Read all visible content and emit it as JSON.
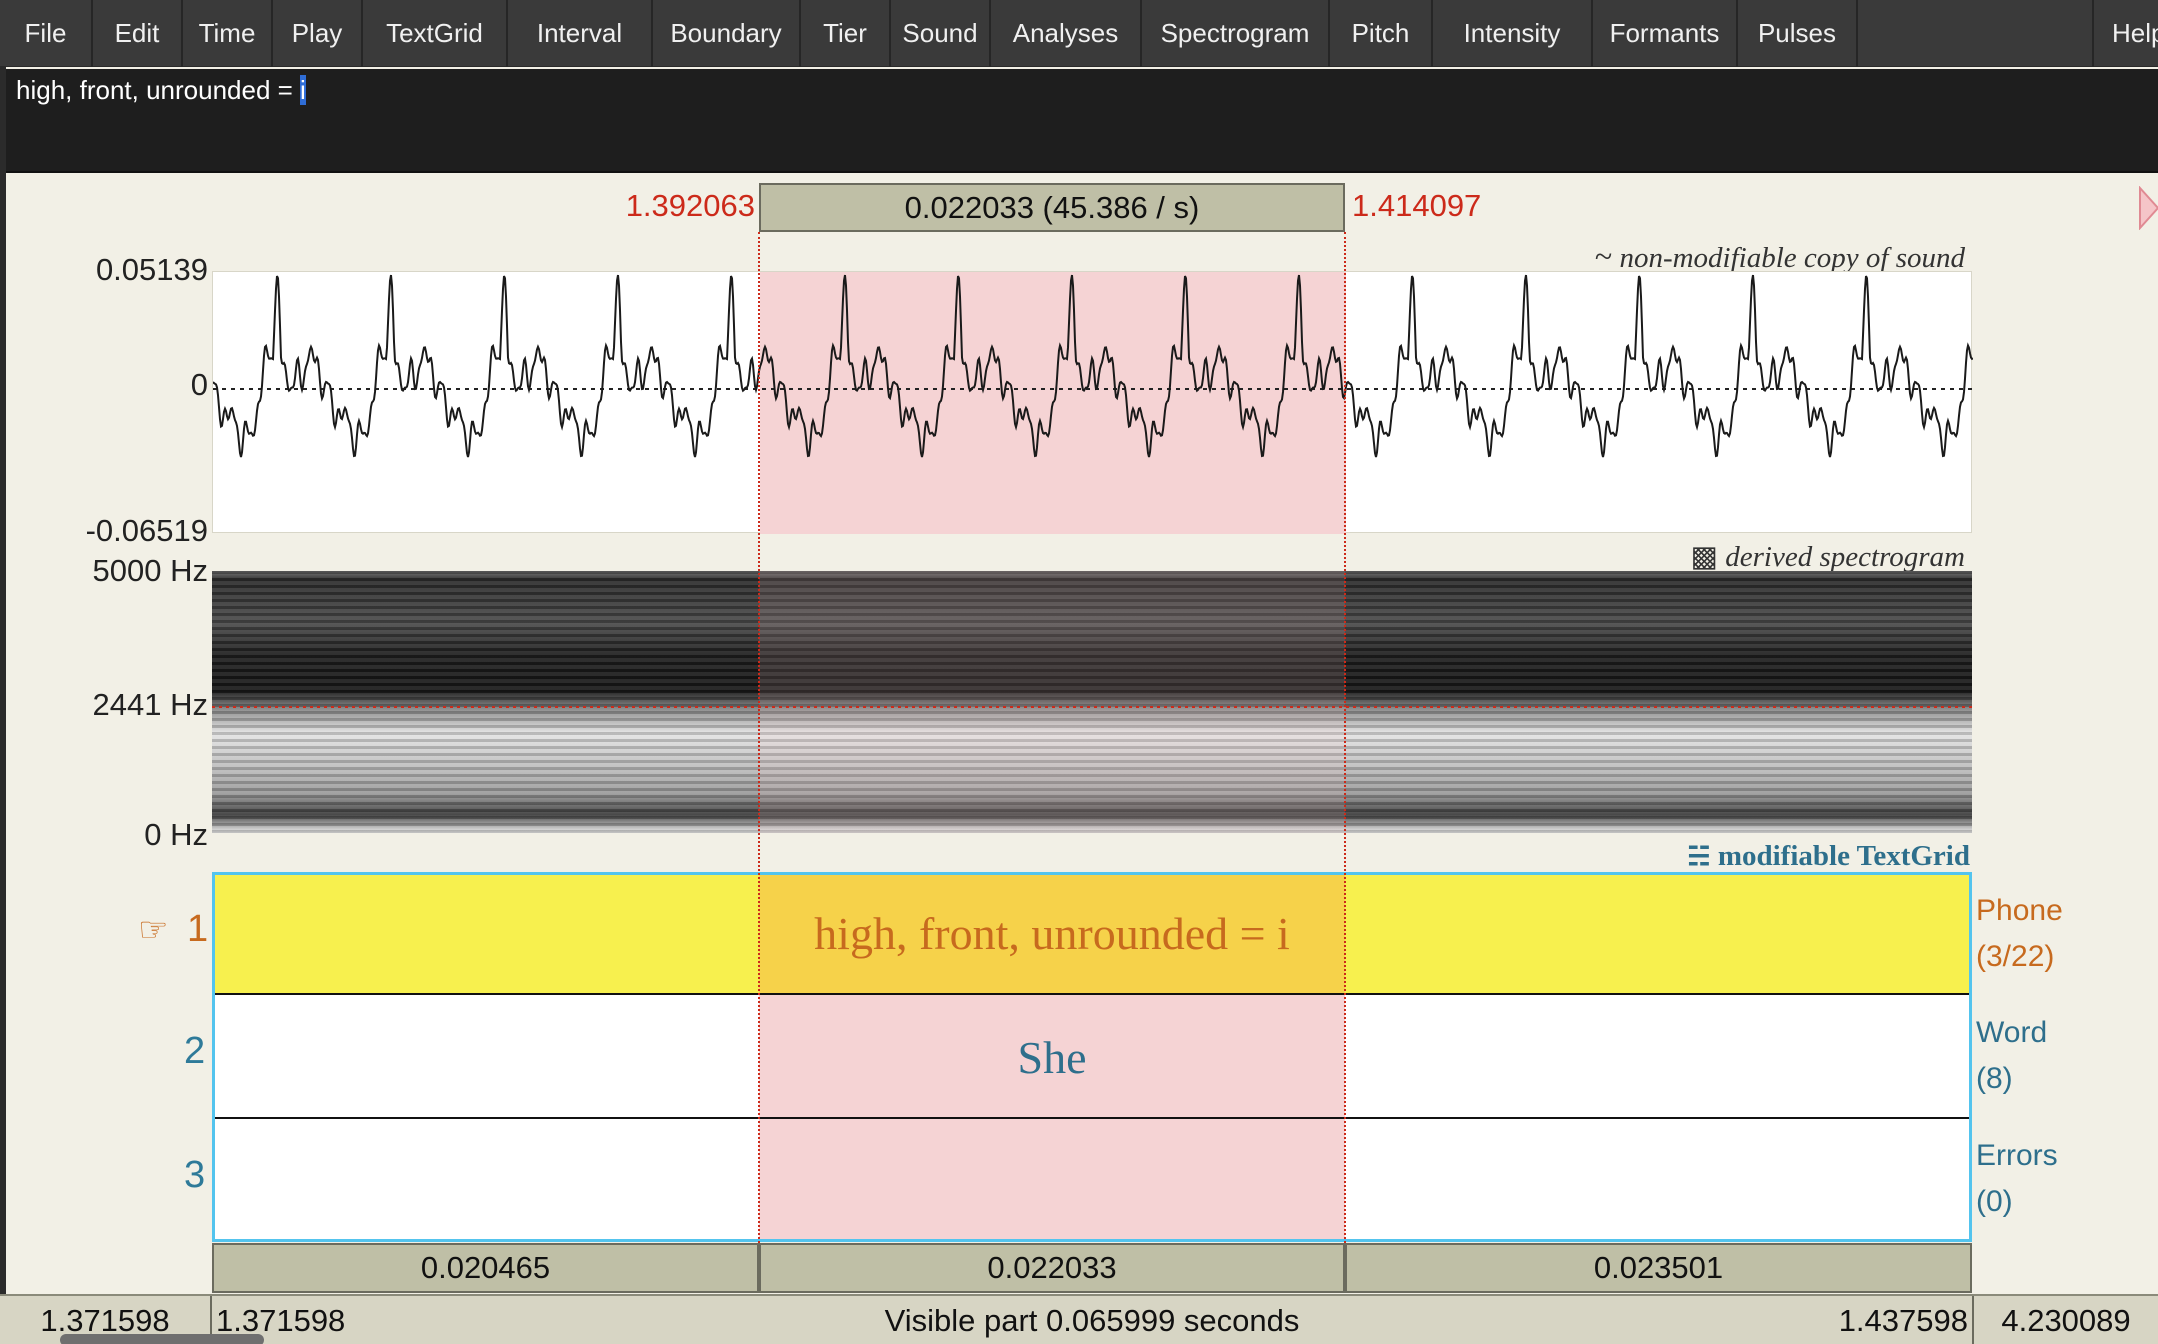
{
  "menu": [
    "File",
    "Edit",
    "Time",
    "Play",
    "TextGrid",
    "Interval",
    "Boundary",
    "Tier",
    "Sound",
    "Analyses",
    "Spectrogram",
    "Pitch",
    "Intensity",
    "Formants",
    "Pulses",
    "Help"
  ],
  "text_field": {
    "prefix": "high, front, unrounded = ",
    "selected": "i"
  },
  "selection": {
    "start": "1.392063",
    "end": "1.414097",
    "duration_label": "0.022033 (45.386 / s)"
  },
  "waveform": {
    "caption_icon": "~",
    "caption": "non-modifiable copy of sound",
    "y_max": "0.05139",
    "y_zero": "0",
    "y_min": "-0.06519"
  },
  "spectrogram": {
    "caption_icon": "▩",
    "caption": "derived spectrogram",
    "f_max": "5000 Hz",
    "cursor_freq": "2441 Hz",
    "f_min": "0 Hz"
  },
  "textgrid": {
    "caption_icon": "☵",
    "caption": "modifiable TextGrid",
    "pointer_icon": "☞",
    "tiers": [
      {
        "number": "1",
        "name": "Phone",
        "count": "(3/22)",
        "selected_text": "high, front, unrounded = i"
      },
      {
        "number": "2",
        "name": "Word",
        "count": "(8)",
        "selected_text": "She"
      },
      {
        "number": "3",
        "name": "Errors",
        "count": "(0)",
        "selected_text": ""
      }
    ]
  },
  "durations": [
    "0.020465",
    "0.022033",
    "0.023501"
  ],
  "bottom": {
    "total_start": "1.371598",
    "visible_start": "1.371598",
    "visible_label": "Visible part 0.065999 seconds",
    "visible_end": "1.437598",
    "total_end": "4.230089"
  },
  "colors": {
    "selection": "#f5d3d4",
    "selected_tier": "#f7f04e",
    "selected_tier_interval": "#f6d24a",
    "cursor": "#cc2a1a",
    "tier_frame": "#53c4ee"
  }
}
